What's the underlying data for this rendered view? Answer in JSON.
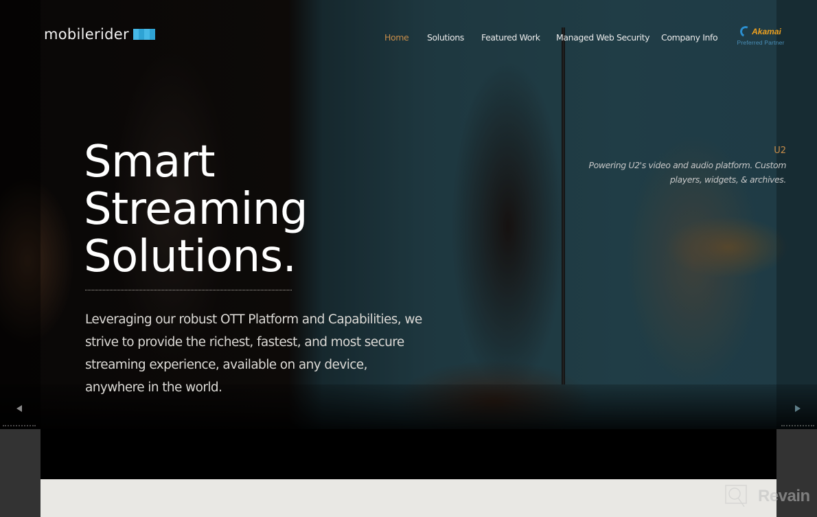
{
  "brand": {
    "name": "mobilerider",
    "accent_color": "#2fa3d4"
  },
  "nav": {
    "items": [
      {
        "label": "Home",
        "active": true
      },
      {
        "label": "Solutions",
        "active": false
      },
      {
        "label": "Featured Work",
        "active": false
      },
      {
        "label": "Managed Web Security",
        "active": false
      },
      {
        "label": "Company Info",
        "active": false
      }
    ],
    "active_color": "#c98e4a"
  },
  "partner": {
    "name": "Akamai",
    "subtitle": "Preferred Partner"
  },
  "hero": {
    "headline": [
      "Smart",
      "Streaming",
      "Solutions."
    ],
    "lead": "Leveraging our robust OTT Platform and Capabilities, we strive to provide the richest, fastest, and most secure streaming experience, available on any device, anywhere in the world."
  },
  "slide": {
    "title": "U2",
    "description": "Powering U2's video and audio platform. Custom players, widgets, & archives.",
    "prev_icon": "triangle-left-icon",
    "next_icon": "triangle-right-icon"
  },
  "watermark": {
    "text": "Revain"
  }
}
